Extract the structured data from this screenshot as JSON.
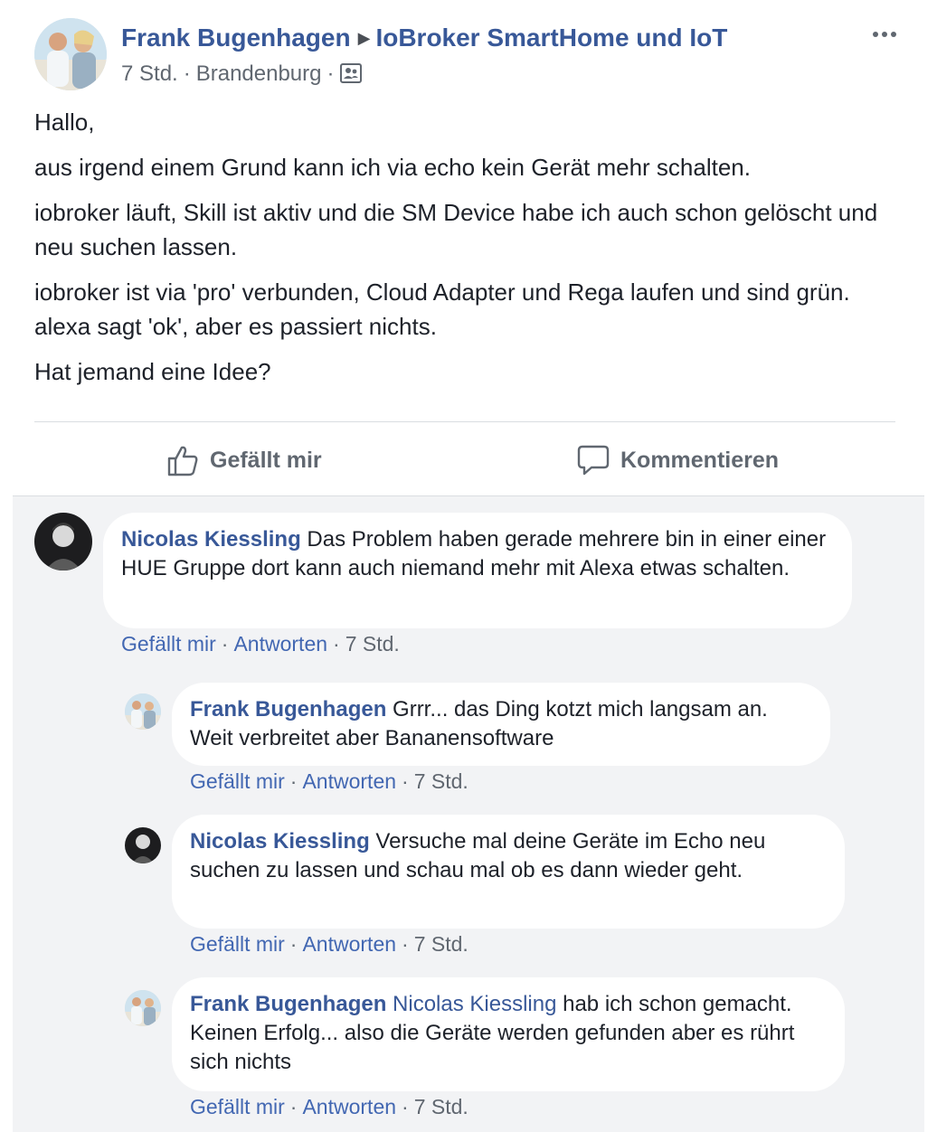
{
  "post": {
    "author": "Frank Bugenhagen",
    "group": "IoBroker SmartHome und IoT",
    "time": "7 Std.",
    "location": "Brandenburg",
    "paragraphs": [
      "Hallo,",
      "aus irgend einem Grund kann ich via echo kein Gerät mehr schalten.",
      "iobroker läuft, Skill ist aktiv und die SM Device habe ich auch schon gelöscht und neu suchen lassen.",
      "iobroker ist via 'pro' verbunden, Cloud Adapter und Rega laufen und sind grün. alexa sagt 'ok', aber es passiert nichts.",
      "Hat jemand eine Idee?"
    ],
    "like_label": "Gefällt mir",
    "comment_label": "Kommentieren"
  },
  "comments": [
    {
      "author": "Nicolas Kiessling",
      "mention": "",
      "text": "Das Problem haben gerade mehrere bin in einer einer HUE Gruppe dort kann auch niemand mehr mit Alexa etwas schalten.",
      "like": "Gefällt mir",
      "reply": "Antworten",
      "time": "7 Std."
    },
    {
      "author": "Frank Bugenhagen",
      "mention": "",
      "text": "Grrr... das Ding kotzt mich langsam an. Weit verbreitet aber Bananensoftware",
      "like": "Gefällt mir",
      "reply": "Antworten",
      "time": "7 Std."
    },
    {
      "author": "Nicolas Kiessling",
      "mention": "",
      "text": "Versuche mal deine Geräte im Echo neu suchen zu lassen und schau mal ob es dann wieder geht.",
      "like": "Gefällt mir",
      "reply": "Antworten",
      "time": "7 Std."
    },
    {
      "author": "Frank Bugenhagen",
      "mention": "Nicolas Kiessling",
      "text": "hab ich schon gemacht. Keinen Erfolg... also die Geräte werden gefunden aber es rührt sich nichts",
      "like": "Gefällt mir",
      "reply": "Antworten",
      "time": "7 Std."
    }
  ],
  "colors": {
    "link": "#385898",
    "secondary_text": "#606770",
    "comment_area_bg": "#f2f3f5"
  },
  "icons": [
    "audience-icon",
    "more-icon",
    "like-icon",
    "comment-icon"
  ]
}
